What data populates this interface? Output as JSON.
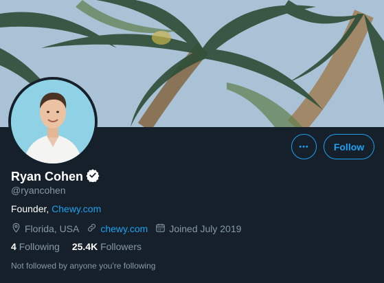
{
  "profile": {
    "display_name": "Ryan Cohen",
    "verified_icon": "verified-badge-icon",
    "handle": "@ryancohen",
    "bio_prefix": "Founder,",
    "bio_link": "Chewy.com",
    "location": "Florida, USA",
    "website": "chewy.com",
    "joined": "Joined July 2019",
    "following_count": "4",
    "following_label": "Following",
    "followers_count": "25.4K",
    "followers_label": "Followers",
    "followed_by_note": "Not followed by anyone you're following"
  },
  "actions": {
    "more_label": "•••",
    "follow_label": "Follow"
  },
  "colors": {
    "background": "#15202b",
    "accent": "#1da1f2",
    "muted": "#8899a6",
    "text": "#ffffff"
  }
}
